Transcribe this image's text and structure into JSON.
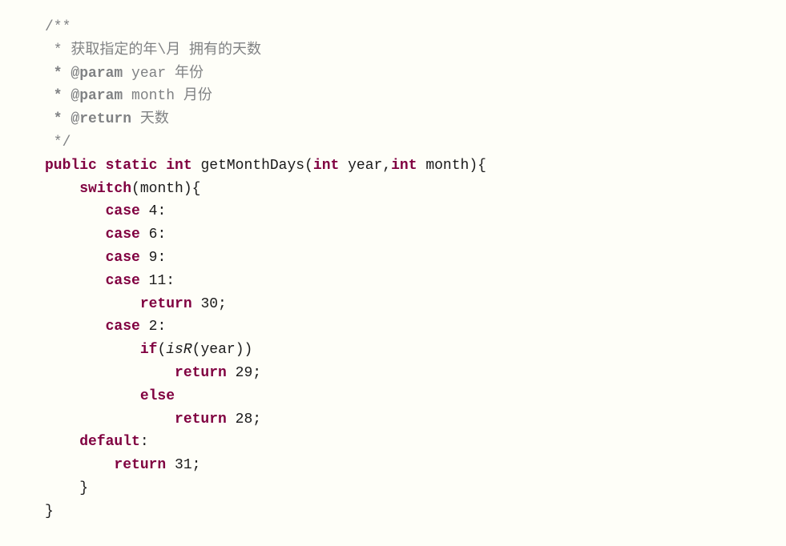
{
  "code": {
    "javadoc": {
      "open": "/**",
      "desc_line": " * 获取指定的年\\月 拥有的天数",
      "param1_tag": " * @param",
      "param1_name": " year",
      "param1_desc": " 年份",
      "param2_tag": " * @param",
      "param2_name": " month",
      "param2_desc": " 月份",
      "return_tag": " * @return",
      "return_desc": " 天数",
      "close": " */"
    },
    "sig": {
      "kw_public": "public",
      "kw_static": "static",
      "kw_int": "int",
      "method": "getMonthDays",
      "paren_open": "(",
      "p1_type": "int",
      "p1_name": " year,",
      "p2_type": "int",
      "p2_name": " month",
      "paren_close": ")",
      "brace_open": "{"
    },
    "switch": {
      "kw_switch": "switch",
      "expr_open": "(",
      "expr": "month",
      "expr_close": ")",
      "brace_open": "{"
    },
    "cases": {
      "kw_case": "case",
      "c4": " 4:",
      "c6": " 6:",
      "c9": " 9:",
      "c11": " 11:",
      "kw_return": "return",
      "v30": " 30;",
      "c2": " 2:",
      "kw_if": "if",
      "if_open": "(",
      "isR": "isR",
      "isR_open": "(",
      "isR_arg": "year",
      "isR_close": ")",
      "if_close": ")",
      "v29": " 29;",
      "kw_else": "else",
      "v28": " 28;",
      "kw_default": "default",
      "default_colon": ":",
      "v31": " 31;"
    },
    "closing": {
      "switch_close": "    }",
      "method_close": "}"
    }
  }
}
